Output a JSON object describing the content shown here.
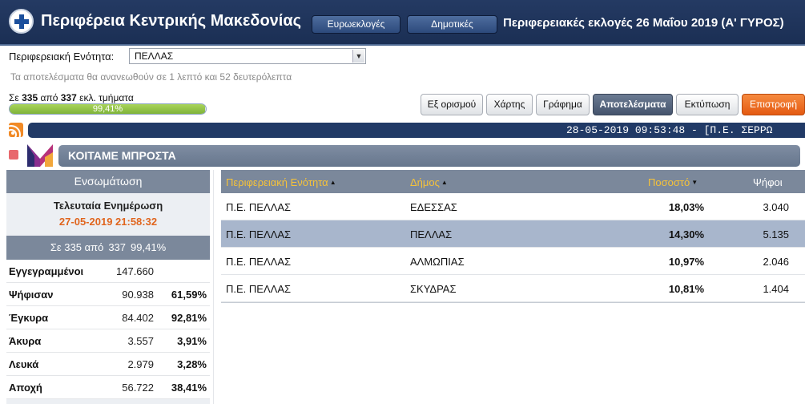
{
  "header": {
    "title": "Περιφέρεια Κεντρικής Μακεδονίας",
    "btn_euro": "Ευρωεκλογές",
    "btn_municipal": "Δημοτικές",
    "subtitle": "Περιφερειακές εκλογές 26 Μαΐου 2019 (Α' ΓΥΡΟΣ)"
  },
  "selector": {
    "label": "Περιφερειακή Ενότητα:",
    "value": "ΠΕΛΛΑΣ",
    "refresh_note": "Τα αποτελέσματα θα ανανεωθούν σε 1 λεπτό και 52 δευτερόλεπτα"
  },
  "count": {
    "prefix": "Σε",
    "counted": "335",
    "mid": "από",
    "total": "337",
    "suffix": "εκλ. τμήματα",
    "progress_label": "99,41%",
    "progress_fraction": 0.9941
  },
  "nav": {
    "candidates": "Εξ ορισμού",
    "map": "Χάρτης",
    "chart": "Γράφημα",
    "results": "Αποτελέσματα",
    "print": "Εκτύπωση",
    "back": "Επιστροφή"
  },
  "ticker": {
    "text": "28-05-2019 09:53:48 - [Π.Ε. ΣΕΡΡΩ"
  },
  "party": {
    "name": "ΚΟΙΤΑΜΕ ΜΠΡΟΣΤΑ",
    "color": "#e8686d"
  },
  "panel": {
    "title": "Ενσωμάτωση",
    "update_label": "Τελευταία Ενημέρωση",
    "update_time": "27-05-2019 21:58:32",
    "count_a": "Σε 335 από",
    "count_b": "337",
    "count_pct": "99,41%",
    "stats": [
      {
        "label": "Εγγεγραμμένοι",
        "value": "147.660",
        "pct": ""
      },
      {
        "label": "Ψήφισαν",
        "value": "90.938",
        "pct": "61,59%"
      },
      {
        "label": "Έγκυρα",
        "value": "84.402",
        "pct": "92,81%"
      },
      {
        "label": "Άκυρα",
        "value": "3.557",
        "pct": "3,91%"
      },
      {
        "label": "Λευκά",
        "value": "2.979",
        "pct": "3,28%"
      },
      {
        "label": "Αποχή",
        "value": "56.722",
        "pct": "38,41%"
      }
    ]
  },
  "table": {
    "headers": {
      "unit": "Περιφερειακή Ενότητα",
      "municipality": "Δήμος",
      "percent": "Ποσοστό",
      "votes": "Ψήφοι"
    },
    "rows": [
      {
        "unit": "Π.Ε. ΠΕΛΛΑΣ",
        "municipality": "ΕΔΕΣΣΑΣ",
        "percent": "18,03%",
        "votes": "3.040",
        "selected": false
      },
      {
        "unit": "Π.Ε. ΠΕΛΛΑΣ",
        "municipality": "ΠΕΛΛΑΣ",
        "percent": "14,30%",
        "votes": "5.135",
        "selected": true
      },
      {
        "unit": "Π.Ε. ΠΕΛΛΑΣ",
        "municipality": "ΑΛΜΩΠΙΑΣ",
        "percent": "10,97%",
        "votes": "2.046",
        "selected": false
      },
      {
        "unit": "Π.Ε. ΠΕΛΛΑΣ",
        "municipality": "ΣΚΥΔΡΑΣ",
        "percent": "10,81%",
        "votes": "1.404",
        "selected": false
      }
    ]
  }
}
